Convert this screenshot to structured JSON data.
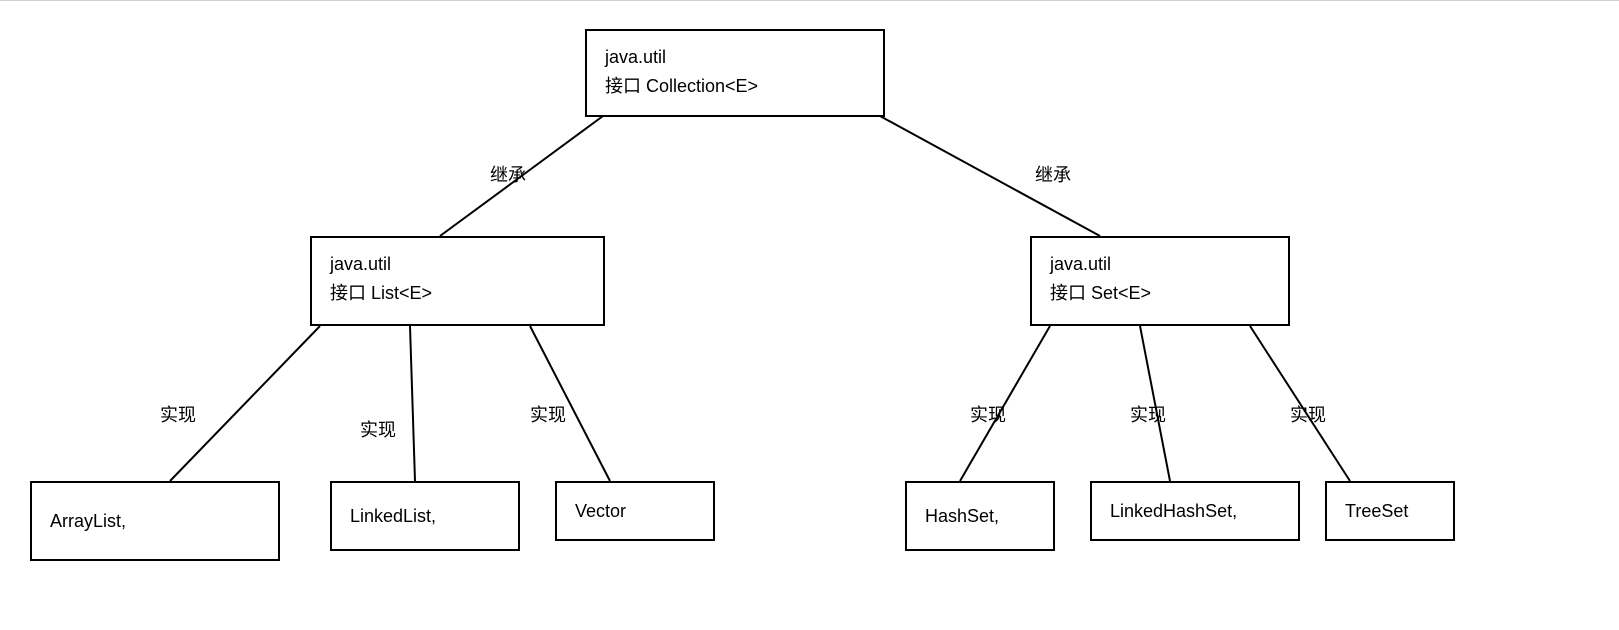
{
  "nodes": {
    "collection": {
      "pkg": "java.util",
      "label": "接口 Collection<E>"
    },
    "list": {
      "pkg": "java.util",
      "label": "接口 List<E>"
    },
    "set": {
      "pkg": "java.util",
      "label": "接口 Set<E>"
    },
    "arraylist": {
      "label": "ArrayList,"
    },
    "linkedlist": {
      "label": "LinkedList,"
    },
    "vector": {
      "label": "Vector"
    },
    "hashset": {
      "label": "HashSet,"
    },
    "linkedhashset": {
      "label": "LinkedHashSet,"
    },
    "treeset": {
      "label": "TreeSet"
    }
  },
  "edgeLabels": {
    "inherit": "继承",
    "implement": "实现"
  }
}
